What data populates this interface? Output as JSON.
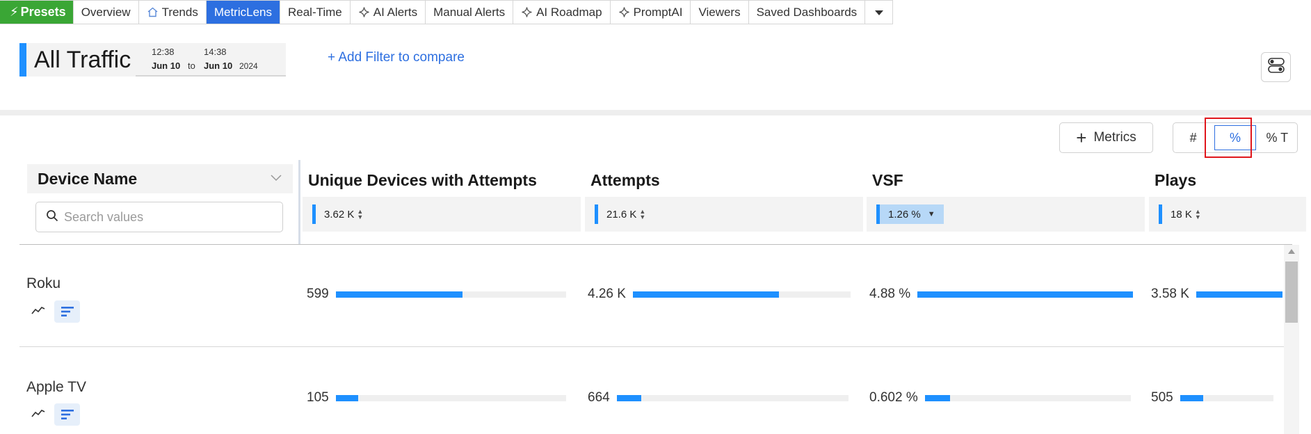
{
  "nav": {
    "presets": "Presets",
    "tabs": [
      {
        "label": "Overview"
      },
      {
        "label": "Trends"
      },
      {
        "label": "MetricLens"
      },
      {
        "label": "Real-Time"
      },
      {
        "label": "AI Alerts"
      },
      {
        "label": "Manual Alerts"
      },
      {
        "label": "AI Roadmap"
      },
      {
        "label": "PromptAI"
      },
      {
        "label": "Viewers"
      },
      {
        "label": "Saved Dashboards"
      }
    ],
    "active_tab": "MetricLens"
  },
  "header": {
    "title": "All Traffic",
    "date_range": {
      "start_time": "12:38",
      "start_date": "Jun 10",
      "separator": "to",
      "end_time": "14:38",
      "end_date": "Jun 10",
      "year": "2024"
    },
    "add_filter": "+ Add Filter to compare"
  },
  "controls": {
    "metrics_label": "Metrics",
    "modes": [
      "#",
      "%",
      "% T"
    ],
    "selected_mode": "%"
  },
  "table": {
    "dimension_header": "Device Name",
    "search_placeholder": "Search values",
    "columns": [
      {
        "name": "Unique Devices with Attempts",
        "total": "3.62 K"
      },
      {
        "name": "Attempts",
        "total": "21.6 K"
      },
      {
        "name": "VSF",
        "total": "1.26 %"
      },
      {
        "name": "Plays",
        "total": "18 K"
      }
    ],
    "rows": [
      {
        "label": "Roku",
        "cells": [
          {
            "value": "599",
            "fraction": 0.55
          },
          {
            "value": "4.26 K",
            "fraction": 0.67
          },
          {
            "value": "4.88 %",
            "fraction": 1.0
          },
          {
            "value": "3.58 K",
            "fraction": 1.0
          }
        ]
      },
      {
        "label": "Apple TV",
        "cells": [
          {
            "value": "105",
            "fraction": 0.097
          },
          {
            "value": "664",
            "fraction": 0.107
          },
          {
            "value": "0.602 %",
            "fraction": 0.123
          },
          {
            "value": "505",
            "fraction": 0.25
          }
        ]
      }
    ]
  },
  "colors": {
    "accent": "#1e90ff",
    "active_tab": "#2d6fe0",
    "presets": "#3aa635",
    "highlight": "#e0161c"
  }
}
